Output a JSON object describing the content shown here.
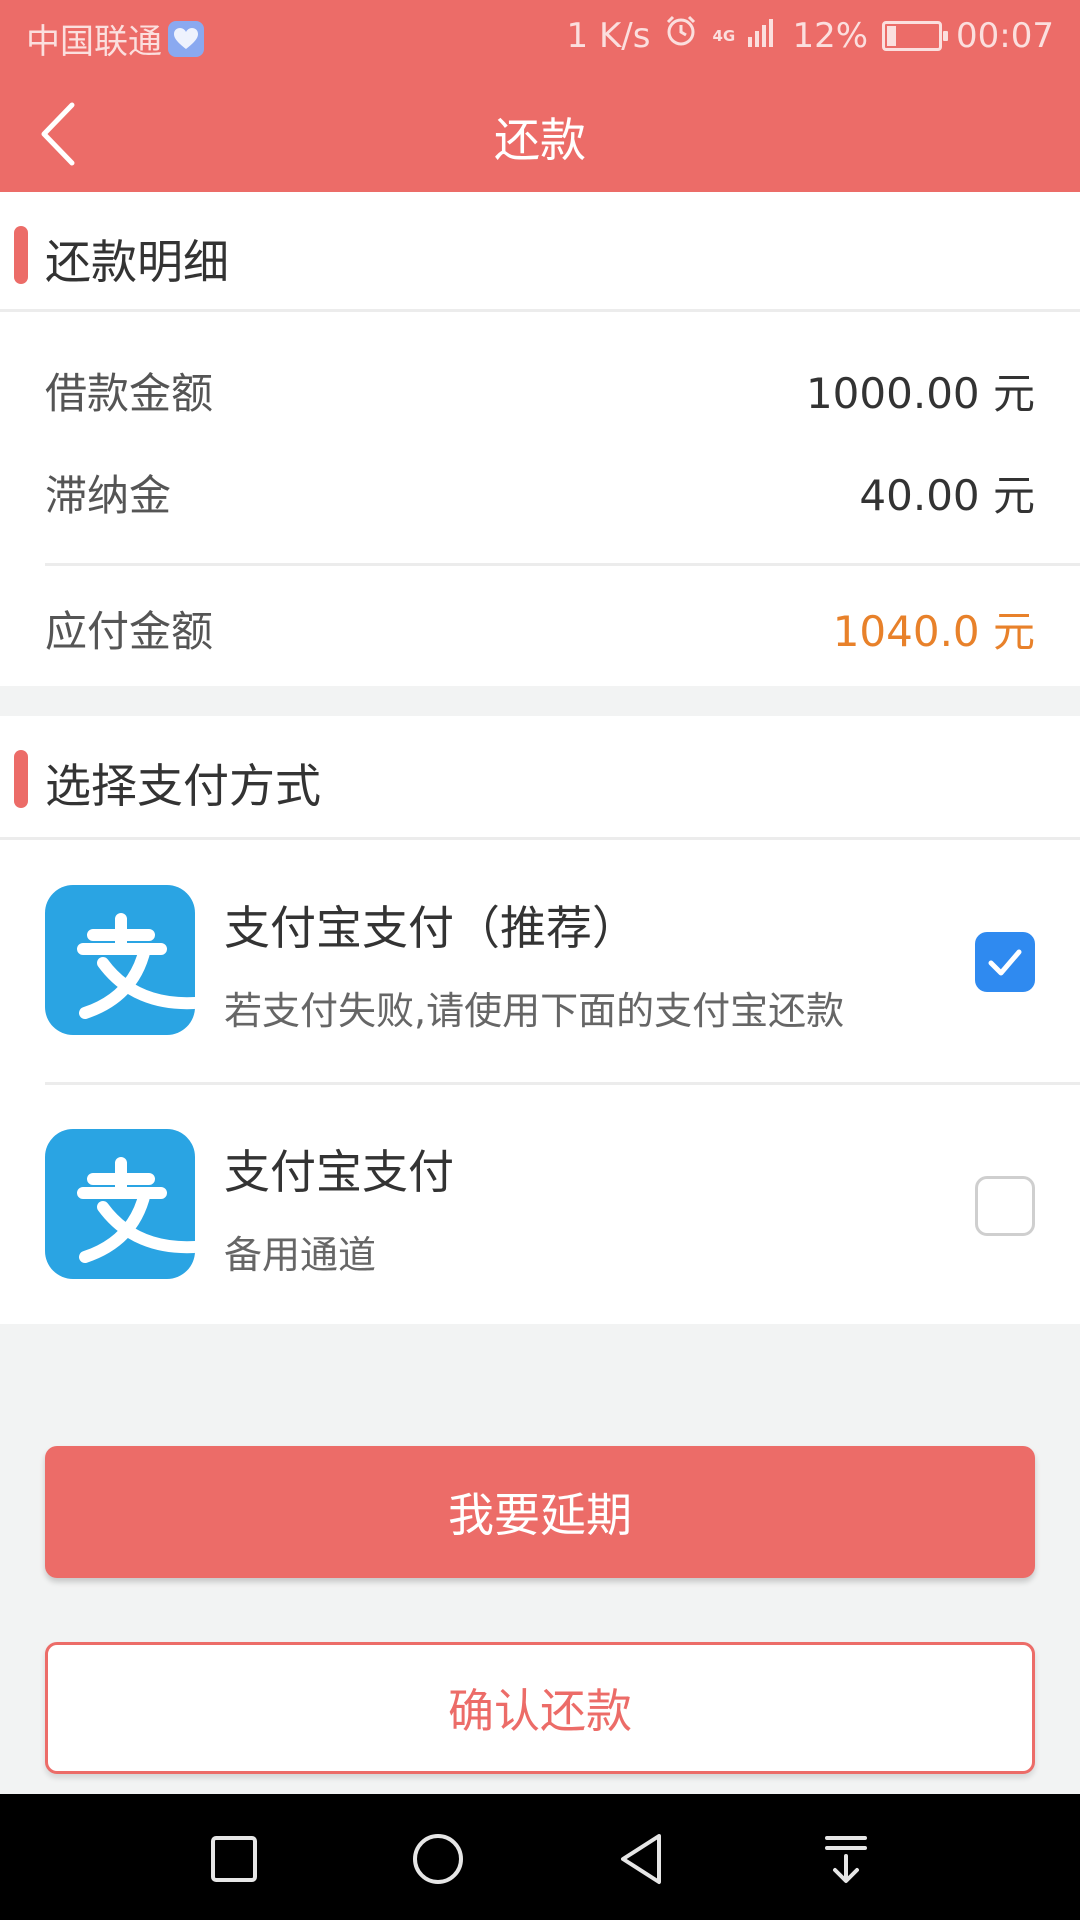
{
  "status_bar": {
    "carrier": "中国联通",
    "speed": "1 K/s",
    "network": "4G",
    "battery": "12%",
    "time": "00:07"
  },
  "header": {
    "title": "还款",
    "back_icon": "chevron-left-icon"
  },
  "details": {
    "section_title": "还款明细",
    "loan_amount_label": "借款金额",
    "loan_amount_value": "1000.00 元",
    "late_fee_label": "滞纳金",
    "late_fee_value": "40.00 元",
    "total_label": "应付金额",
    "total_value": "1040.0 元"
  },
  "payment": {
    "section_title": "选择支付方式",
    "options": [
      {
        "title": "支付宝支付（推荐）",
        "subtitle": "若支付失败,请使用下面的支付宝还款",
        "checked": true,
        "icon": "alipay-logo-icon"
      },
      {
        "title": "支付宝支付",
        "subtitle": "备用通道",
        "checked": false,
        "icon": "alipay-logo-icon"
      }
    ]
  },
  "buttons": {
    "extend_label": "我要延期",
    "confirm_label": "确认还款"
  },
  "colors": {
    "accent": "#ec6c68",
    "amount_highlight": "#e8812a",
    "checkbox_checked": "#2f8af0",
    "alipay_blue": "#2aa4e3"
  }
}
